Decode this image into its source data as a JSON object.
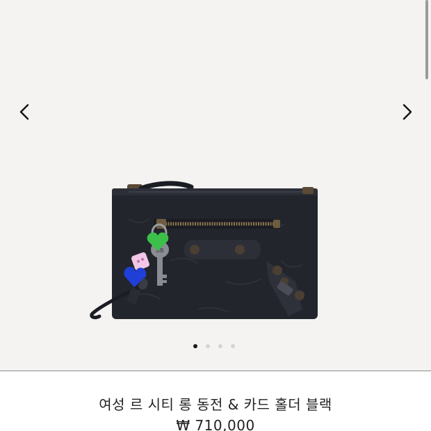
{
  "colors": {
    "gallery_background": "#f4f3f1",
    "text": "#222222",
    "dot_active": "#1a1a1a",
    "dot_inactive": "#d4d4d4"
  },
  "gallery": {
    "prev_icon": "chevron-left-icon",
    "next_icon": "chevron-right-icon",
    "slide_count": 4,
    "active_slide": 1
  },
  "product": {
    "title": "여성 르 시티 롱 동전 & 카드 홀더 블랙",
    "price": "₩ 710,000"
  }
}
